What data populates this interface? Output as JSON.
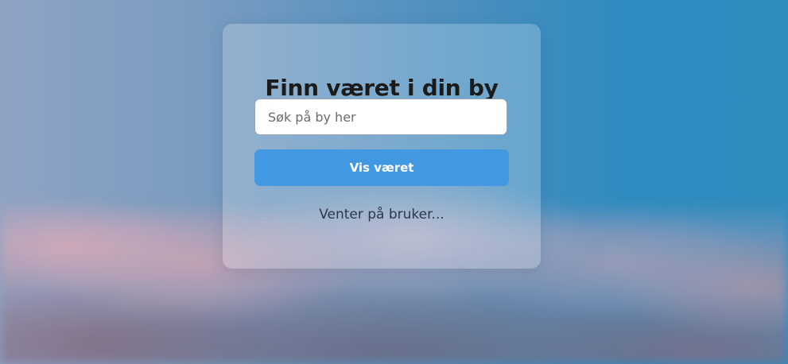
{
  "card": {
    "title": "Finn været i din by",
    "search": {
      "placeholder": "Søk på by her",
      "value": ""
    },
    "button_label": "Vis været",
    "status_text": "Venter på bruker..."
  },
  "colors": {
    "button": "#4299e1",
    "title": "#1b1b1b",
    "status": "#2e3748"
  }
}
